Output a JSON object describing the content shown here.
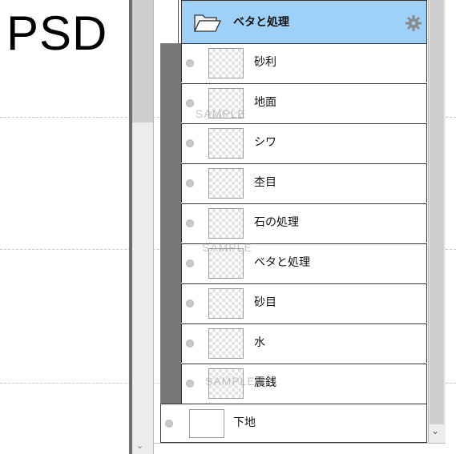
{
  "title": "PSD",
  "group": {
    "label": "ベタと処理",
    "icon": "folder-icon",
    "settings_icon": "gear-icon"
  },
  "layers": [
    {
      "label": "砂利"
    },
    {
      "label": "地面"
    },
    {
      "label": "シワ"
    },
    {
      "label": "杢目"
    },
    {
      "label": "石の処理"
    },
    {
      "label": "ベタと処理"
    },
    {
      "label": "砂目"
    },
    {
      "label": "水"
    },
    {
      "label": "震銭"
    }
  ],
  "base_layer": {
    "label": "下地"
  },
  "watermark": "SAMPLE",
  "colors": {
    "selected_row": "#9fd0f7",
    "group_strip": "#777777",
    "visibility_dot": "#c9c9c9"
  }
}
